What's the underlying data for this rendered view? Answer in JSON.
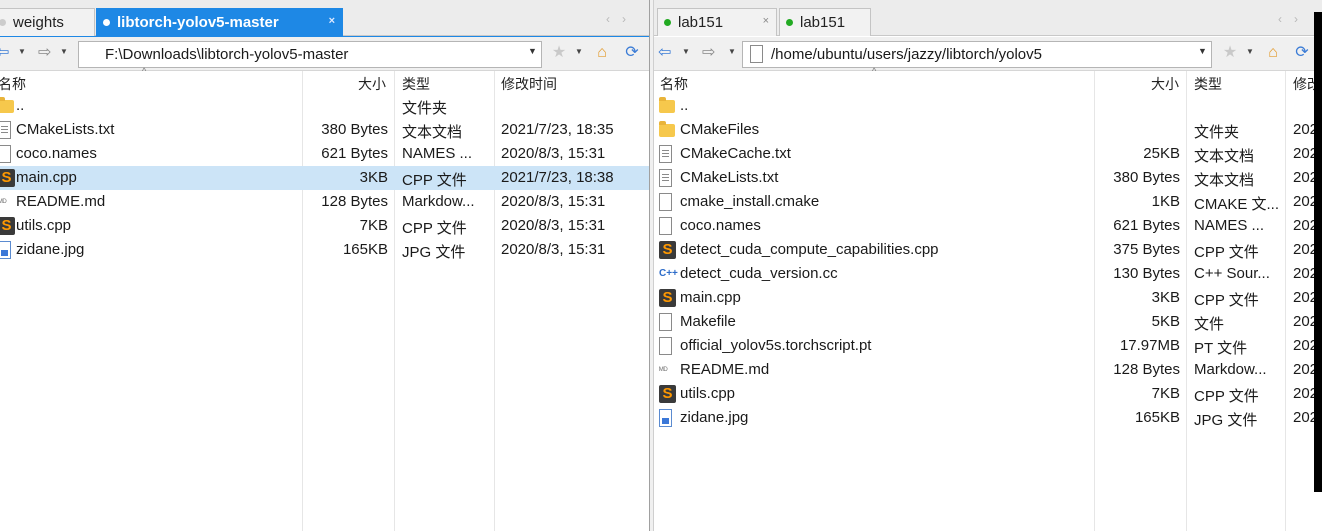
{
  "left": {
    "tabs": [
      {
        "label": "weights",
        "active": false,
        "dot_color": "#cccccc"
      },
      {
        "label": "libtorch-yolov5-master",
        "active": true,
        "dot_color": "#ffffff"
      }
    ],
    "close_glyph": "×",
    "path": "F:\\Downloads\\libtorch-yolov5-master",
    "columns": {
      "name": "名称",
      "size": "大小",
      "type": "类型",
      "modified": "修改时间"
    },
    "files": [
      {
        "icon": "folder",
        "name": "..",
        "size": "",
        "type": "文件夹",
        "modified": ""
      },
      {
        "icon": "text",
        "name": "CMakeLists.txt",
        "size": "380 Bytes",
        "type": "文本文档",
        "modified": "2021/7/23, 18:35"
      },
      {
        "icon": "blank",
        "name": "coco.names",
        "size": "621 Bytes",
        "type": "NAMES ...",
        "modified": "2020/8/3, 15:31"
      },
      {
        "icon": "sublime",
        "name": "main.cpp",
        "size": "3KB",
        "type": "CPP 文件",
        "modified": "2021/7/23, 18:38",
        "selected": true
      },
      {
        "icon": "markdown",
        "name": "README.md",
        "size": "128 Bytes",
        "type": "Markdow...",
        "modified": "2020/8/3, 15:31"
      },
      {
        "icon": "sublime",
        "name": "utils.cpp",
        "size": "7KB",
        "type": "CPP 文件",
        "modified": "2020/8/3, 15:31"
      },
      {
        "icon": "image",
        "name": "zidane.jpg",
        "size": "165KB",
        "type": "JPG 文件",
        "modified": "2020/8/3, 15:31"
      }
    ]
  },
  "right": {
    "tabs": [
      {
        "label": "lab151",
        "active": false,
        "dot_color": "#22aa22"
      },
      {
        "label": "lab151",
        "active": false,
        "dot_color": "#22aa22"
      }
    ],
    "close_glyph": "×",
    "path": "/home/ubuntu/users/jazzy/libtorch/yolov5",
    "columns": {
      "name": "名称",
      "size": "大小",
      "type": "类型",
      "modified": "修改"
    },
    "files": [
      {
        "icon": "folder",
        "name": "..",
        "size": "",
        "type": "",
        "modified": ""
      },
      {
        "icon": "folder",
        "name": "CMakeFiles",
        "size": "",
        "type": "文件夹",
        "modified": "202"
      },
      {
        "icon": "text",
        "name": "CMakeCache.txt",
        "size": "25KB",
        "type": "文本文档",
        "modified": "202"
      },
      {
        "icon": "text",
        "name": "CMakeLists.txt",
        "size": "380 Bytes",
        "type": "文本文档",
        "modified": "202"
      },
      {
        "icon": "blank",
        "name": "cmake_install.cmake",
        "size": "1KB",
        "type": "CMAKE 文...",
        "modified": "202"
      },
      {
        "icon": "blank",
        "name": "coco.names",
        "size": "621 Bytes",
        "type": "NAMES ...",
        "modified": "202"
      },
      {
        "icon": "sublime",
        "name": "detect_cuda_compute_capabilities.cpp",
        "size": "375 Bytes",
        "type": "CPP 文件",
        "modified": "202"
      },
      {
        "icon": "cpp",
        "name": "detect_cuda_version.cc",
        "size": "130 Bytes",
        "type": "C++ Sour...",
        "modified": "202"
      },
      {
        "icon": "sublime",
        "name": "main.cpp",
        "size": "3KB",
        "type": "CPP 文件",
        "modified": "202"
      },
      {
        "icon": "blank",
        "name": "Makefile",
        "size": "5KB",
        "type": "文件",
        "modified": "202"
      },
      {
        "icon": "blank",
        "name": "official_yolov5s.torchscript.pt",
        "size": "17.97MB",
        "type": "PT 文件",
        "modified": "202"
      },
      {
        "icon": "markdown",
        "name": "README.md",
        "size": "128 Bytes",
        "type": "Markdow...",
        "modified": "202"
      },
      {
        "icon": "sublime",
        "name": "utils.cpp",
        "size": "7KB",
        "type": "CPP 文件",
        "modified": "202"
      },
      {
        "icon": "image",
        "name": "zidane.jpg",
        "size": "165KB",
        "type": "JPG 文件",
        "modified": "202"
      }
    ]
  },
  "icons": {
    "back": "back-arrow-icon",
    "forward": "forward-arrow-icon",
    "star": "star-icon",
    "home": "home-folder-icon",
    "refresh": "refresh-icon",
    "sort": "sort-up-icon"
  },
  "glyphs": {
    "back": "⇦",
    "forward": "⇨",
    "drop": "▼",
    "chev": "⌄",
    "star": "★",
    "home": "⌂",
    "refresh": "⟳",
    "sort": "^",
    "sublime": "S",
    "markdown": "ᴹᴰ",
    "cpp": "C++",
    "prev": "‹",
    "next": "›"
  },
  "colors": {
    "accent": "#1e88e5",
    "selected_row": "#cce4f7",
    "online_dot": "#22aa22"
  }
}
